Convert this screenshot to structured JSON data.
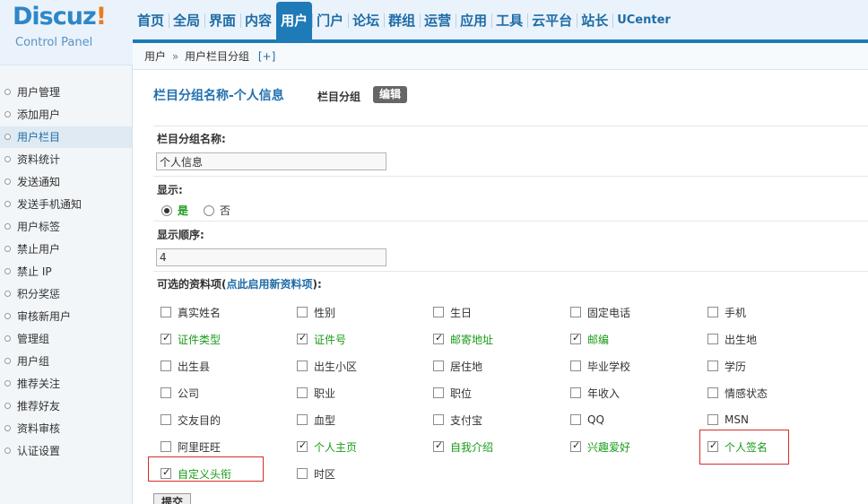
{
  "logo": {
    "title": "Discuz",
    "bang": "!",
    "subtitle": "Control Panel"
  },
  "nav": [
    "首页",
    "全局",
    "界面",
    "内容",
    "用户",
    "门户",
    "论坛",
    "群组",
    "运营",
    "应用",
    "工具",
    "云平台",
    "站长",
    "UCenter"
  ],
  "breadcrumb": {
    "root": "用户",
    "sep": "»",
    "current": "用户栏目分组",
    "add": "[+]"
  },
  "sidebar": [
    "用户管理",
    "添加用户",
    "用户栏目",
    "资料统计",
    "发送通知",
    "发送手机通知",
    "用户标签",
    "禁止用户",
    "禁止 IP",
    "积分奖惩",
    "审核新用户",
    "管理组",
    "用户组",
    "推荐关注",
    "推荐好友",
    "资料审核",
    "认证设置"
  ],
  "page": {
    "title": "栏目分组名称-个人信息",
    "sub_label": "栏目分组",
    "edit_button": "编辑"
  },
  "form": {
    "name_label": "栏目分组名称:",
    "name_value": "个人信息",
    "show_label": "显示:",
    "show_yes": "是",
    "show_no": "否",
    "order_label": "显示顺序:",
    "order_value": "4",
    "options_label_pre": "可选的资料项(",
    "options_link": "点此启用新资料项",
    "options_label_post": "):",
    "submit": "提交"
  },
  "fields": [
    {
      "label": "真实姓名",
      "checked": false
    },
    {
      "label": "性别",
      "checked": false
    },
    {
      "label": "生日",
      "checked": false
    },
    {
      "label": "固定电话",
      "checked": false
    },
    {
      "label": "手机",
      "checked": false
    },
    {
      "label": "证件类型",
      "checked": true
    },
    {
      "label": "证件号",
      "checked": true
    },
    {
      "label": "邮寄地址",
      "checked": true
    },
    {
      "label": "邮编",
      "checked": true
    },
    {
      "label": "出生地",
      "checked": false
    },
    {
      "label": "出生县",
      "checked": false
    },
    {
      "label": "出生小区",
      "checked": false
    },
    {
      "label": "居住地",
      "checked": false
    },
    {
      "label": "毕业学校",
      "checked": false
    },
    {
      "label": "学历",
      "checked": false
    },
    {
      "label": "公司",
      "checked": false
    },
    {
      "label": "职业",
      "checked": false
    },
    {
      "label": "职位",
      "checked": false
    },
    {
      "label": "年收入",
      "checked": false
    },
    {
      "label": "情感状态",
      "checked": false
    },
    {
      "label": "交友目的",
      "checked": false
    },
    {
      "label": "血型",
      "checked": false
    },
    {
      "label": "支付宝",
      "checked": false
    },
    {
      "label": "QQ",
      "checked": false
    },
    {
      "label": "MSN",
      "checked": false
    },
    {
      "label": "阿里旺旺",
      "checked": false
    },
    {
      "label": "个人主页",
      "checked": true
    },
    {
      "label": "自我介绍",
      "checked": true
    },
    {
      "label": "兴趣爱好",
      "checked": true
    },
    {
      "label": "个人签名",
      "checked": true
    },
    {
      "label": "自定义头衔",
      "checked": true
    },
    {
      "label": "时区",
      "checked": false
    }
  ],
  "colors": {
    "accent": "#1f7ab8",
    "enabled_text": "#1a9b1a",
    "highlight_box": "#d62b2b"
  }
}
